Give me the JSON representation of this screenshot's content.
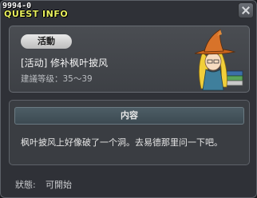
{
  "window": {
    "quest_id": "9994-0",
    "title": "QUEST INFO"
  },
  "summary": {
    "tag": "活動",
    "quest_name": "[活动] 修补枫叶披风",
    "level_label": "建議等级：35～39"
  },
  "content": {
    "header": "内容",
    "text": "枫叶披风上好像破了一个洞。去易德那里问一下吧。"
  },
  "status": {
    "label": "狀態:",
    "value": "可開始"
  },
  "colors": {
    "title": "#e9f05e",
    "background": "#2f3137",
    "panel": "#4a4d52"
  },
  "icons": {
    "close": "close-icon",
    "npc": "wizard-npc-portrait"
  }
}
